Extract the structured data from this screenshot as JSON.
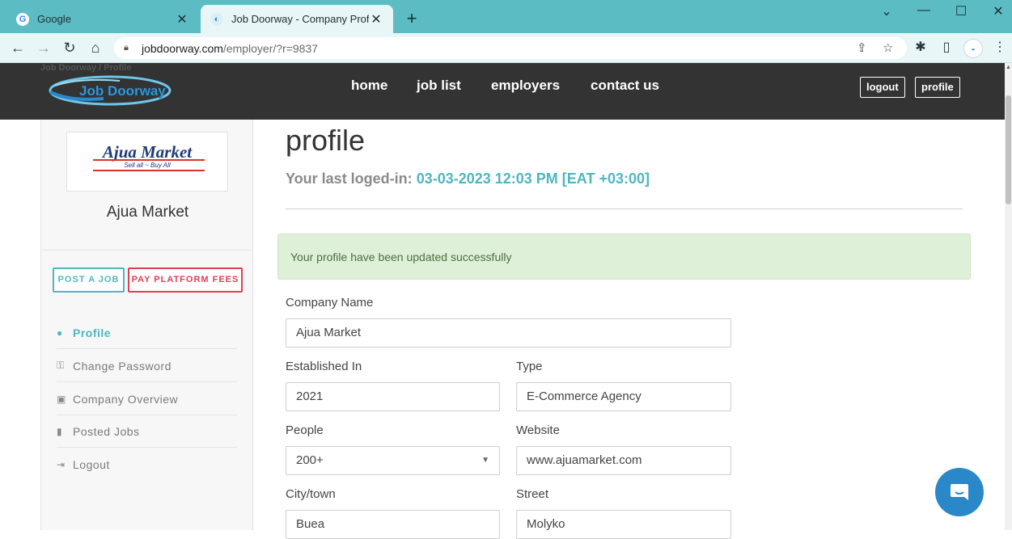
{
  "browser": {
    "tabs": [
      {
        "title": "Google",
        "favicon": "google-icon",
        "active": false
      },
      {
        "title": "Job Doorway - Company Profile",
        "favicon": "site-icon",
        "active": true
      }
    ],
    "url_host": "jobdoorway.com",
    "url_path": "/employer/?r=9837"
  },
  "header": {
    "breadcrumb": "Job Doorway  /  Profile",
    "logo_text": "Job Doorway",
    "nav": [
      "home",
      "job list",
      "employers",
      "contact us"
    ],
    "logout_label": "logout",
    "profile_label": "profile"
  },
  "sidebar": {
    "logo_text": "Ajua Market",
    "logo_tagline": "Sell all ~ Buy All",
    "company_name": "Ajua Market",
    "post_job_label": "POST A JOB",
    "pay_fees_label": "PAY PLATFORM FEES",
    "menu": [
      {
        "label": "Profile",
        "icon": "user-icon",
        "active": true
      },
      {
        "label": "Change Password",
        "icon": "key-icon",
        "active": false
      },
      {
        "label": "Company Overview",
        "icon": "briefcase-icon",
        "active": false
      },
      {
        "label": "Posted Jobs",
        "icon": "bookmark-icon",
        "active": false
      },
      {
        "label": "Logout",
        "icon": "sign-out-icon",
        "active": false
      }
    ]
  },
  "main": {
    "title": "profile",
    "last_login_label": "Your last loged-in:",
    "last_login_value": "03-03-2023 12:03 PM [EAT +03:00]",
    "alert": "Your profile have been updated successfully",
    "form": {
      "company_name_label": "Company Name",
      "company_name": "Ajua Market",
      "established_label": "Established In",
      "established": "2021",
      "type_label": "Type",
      "type": "E-Commerce Agency",
      "people_label": "People",
      "people": "200+",
      "website_label": "Website",
      "website": "www.ajuamarket.com",
      "city_label": "City/town",
      "city": "Buea",
      "street_label": "Street",
      "street": "Molyko"
    }
  },
  "colors": {
    "accent": "#4fb6c1",
    "danger": "#e43d53",
    "header_bg": "#333333",
    "chrome": "#5bbcc4",
    "chat": "#2a88c8"
  }
}
